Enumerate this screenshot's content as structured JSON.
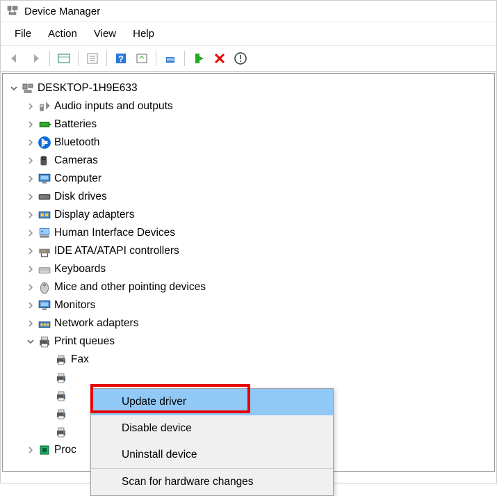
{
  "window": {
    "title": "Device Manager"
  },
  "menubar": {
    "file": "File",
    "action": "Action",
    "view": "View",
    "help": "Help"
  },
  "tree": {
    "root": "DESKTOP-1H9E633",
    "categories": [
      "Audio inputs and outputs",
      "Batteries",
      "Bluetooth",
      "Cameras",
      "Computer",
      "Disk drives",
      "Display adapters",
      "Human Interface Devices",
      "IDE ATA/ATAPI controllers",
      "Keyboards",
      "Mice and other pointing devices",
      "Monitors",
      "Network adapters",
      "Print queues"
    ],
    "print_queues_children": [
      "Fax"
    ],
    "partial_last": "Proc"
  },
  "context_menu": {
    "update_driver": "Update driver",
    "disable_device": "Disable device",
    "uninstall_device": "Uninstall device",
    "scan_hardware": "Scan for hardware changes"
  }
}
